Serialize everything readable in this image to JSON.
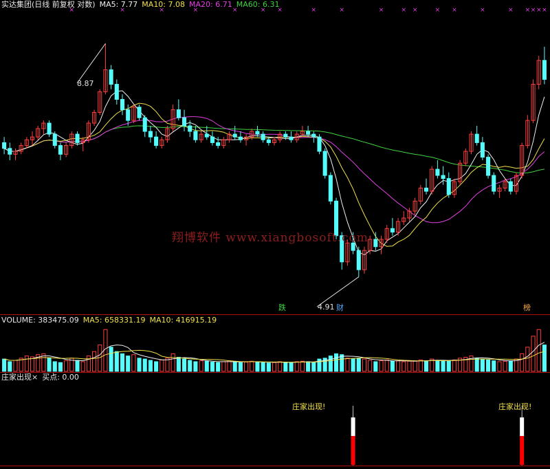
{
  "main_header": {
    "title": "实达集团(日线 前复权 对数)",
    "ma5": "MA5: 7.77",
    "ma10": "MA10: 7.08",
    "ma20": "MA20: 6.71",
    "ma60": "MA60: 6.31"
  },
  "volume_header": {
    "title": "VOLUME: 383475.09",
    "ma5": "MA5: 658331.19",
    "ma10": "MA10: 416915.19"
  },
  "signal_header": {
    "title": "庄家出现",
    "close_mark": "×",
    "buy_point": "买点: 0.00"
  },
  "annotations": {
    "high_label": "8.87",
    "low_label": "4.91",
    "tag_die": "跌",
    "tag_cai": "财",
    "tag_bang": "榜",
    "signal_text": "庄家出现!"
  },
  "watermark": "翔博软件 www.xiangbosoft.com",
  "colors": {
    "up": "#ff4040",
    "down": "#54fcfc",
    "ma5": "#f0f0f0",
    "ma10": "#f2e14a",
    "ma20": "#e23ee2",
    "ma60": "#3fd33f",
    "marker": "#e23ee2",
    "divider": "#b01010",
    "signal_red": "#ff0000"
  },
  "chart_data": {
    "type": "candlestick",
    "price_scale": "log",
    "price_range": [
      4.6,
      9.6
    ],
    "max_price": 8.87,
    "min_price": 4.91,
    "candles": [
      [
        6.9,
        7.0,
        6.7,
        6.8
      ],
      [
        6.8,
        6.9,
        6.6,
        6.7
      ],
      [
        6.7,
        6.8,
        6.6,
        6.75
      ],
      [
        6.75,
        6.9,
        6.7,
        6.85
      ],
      [
        6.85,
        7.0,
        6.8,
        6.95
      ],
      [
        6.95,
        7.1,
        6.85,
        7.0
      ],
      [
        7.0,
        7.2,
        6.95,
        7.15
      ],
      [
        7.15,
        7.3,
        7.05,
        7.25
      ],
      [
        7.25,
        7.3,
        7.0,
        7.05
      ],
      [
        7.05,
        7.1,
        6.8,
        6.85
      ],
      [
        6.85,
        6.9,
        6.6,
        6.7
      ],
      [
        6.7,
        6.9,
        6.65,
        6.85
      ],
      [
        6.85,
        7.1,
        6.8,
        7.05
      ],
      [
        7.05,
        7.1,
        6.85,
        6.9
      ],
      [
        6.9,
        7.0,
        6.75,
        6.95
      ],
      [
        6.95,
        7.3,
        6.9,
        7.25
      ],
      [
        7.25,
        7.5,
        7.2,
        7.45
      ],
      [
        7.45,
        7.9,
        7.4,
        7.85
      ],
      [
        7.85,
        8.87,
        7.8,
        8.3
      ],
      [
        8.3,
        8.4,
        7.9,
        8.0
      ],
      [
        8.0,
        8.1,
        7.6,
        7.7
      ],
      [
        7.7,
        7.8,
        7.4,
        7.5
      ],
      [
        7.5,
        7.6,
        7.2,
        7.3
      ],
      [
        7.3,
        7.6,
        7.25,
        7.55
      ],
      [
        7.55,
        7.6,
        7.3,
        7.35
      ],
      [
        7.35,
        7.4,
        7.0,
        7.1
      ],
      [
        7.1,
        7.2,
        6.9,
        7.0
      ],
      [
        7.0,
        7.1,
        6.8,
        6.85
      ],
      [
        6.85,
        7.0,
        6.8,
        6.95
      ],
      [
        6.95,
        7.2,
        6.9,
        7.15
      ],
      [
        7.15,
        7.6,
        7.1,
        7.5
      ],
      [
        7.5,
        7.7,
        7.3,
        7.35
      ],
      [
        7.35,
        7.5,
        7.1,
        7.2
      ],
      [
        7.2,
        7.3,
        7.0,
        7.1
      ],
      [
        7.1,
        7.2,
        6.9,
        6.95
      ],
      [
        6.95,
        7.1,
        6.9,
        7.05
      ],
      [
        7.05,
        7.2,
        6.95,
        7.0
      ],
      [
        7.0,
        7.1,
        6.85,
        6.9
      ],
      [
        6.9,
        7.0,
        6.8,
        6.85
      ],
      [
        6.85,
        7.0,
        6.8,
        6.95
      ],
      [
        6.95,
        7.1,
        6.9,
        7.05
      ],
      [
        7.05,
        7.2,
        6.95,
        7.0
      ],
      [
        7.0,
        7.1,
        6.9,
        6.95
      ],
      [
        6.95,
        7.05,
        6.85,
        7.0
      ],
      [
        7.0,
        7.15,
        6.95,
        7.1
      ],
      [
        7.1,
        7.2,
        7.0,
        7.05
      ],
      [
        7.05,
        7.1,
        6.9,
        6.95
      ],
      [
        6.95,
        7.0,
        6.85,
        6.9
      ],
      [
        6.9,
        7.0,
        6.85,
        6.95
      ],
      [
        6.95,
        7.1,
        6.9,
        7.05
      ],
      [
        7.05,
        7.1,
        6.95,
        7.0
      ],
      [
        7.0,
        7.1,
        6.9,
        6.95
      ],
      [
        6.95,
        7.1,
        6.9,
        7.05
      ],
      [
        7.05,
        7.2,
        7.0,
        7.1
      ],
      [
        7.1,
        7.2,
        7.0,
        7.05
      ],
      [
        7.05,
        7.1,
        6.9,
        7.0
      ],
      [
        7.0,
        7.05,
        6.7,
        6.75
      ],
      [
        6.75,
        6.8,
        6.3,
        6.35
      ],
      [
        6.35,
        6.4,
        5.9,
        5.95
      ],
      [
        5.95,
        6.0,
        5.4,
        5.45
      ],
      [
        5.45,
        5.5,
        5.0,
        5.1
      ],
      [
        5.1,
        5.4,
        5.05,
        5.35
      ],
      [
        5.35,
        5.5,
        5.2,
        5.25
      ],
      [
        5.25,
        5.3,
        4.91,
        5.0
      ],
      [
        5.0,
        5.3,
        4.95,
        5.25
      ],
      [
        5.25,
        5.45,
        5.2,
        5.4
      ],
      [
        5.4,
        5.5,
        5.25,
        5.3
      ],
      [
        5.3,
        5.45,
        5.2,
        5.4
      ],
      [
        5.4,
        5.6,
        5.35,
        5.55
      ],
      [
        5.55,
        5.7,
        5.45,
        5.5
      ],
      [
        5.5,
        5.7,
        5.45,
        5.65
      ],
      [
        5.65,
        5.8,
        5.6,
        5.7
      ],
      [
        5.7,
        5.85,
        5.65,
        5.8
      ],
      [
        5.8,
        6.0,
        5.75,
        5.95
      ],
      [
        5.95,
        6.2,
        5.9,
        6.15
      ],
      [
        6.15,
        6.3,
        6.05,
        6.1
      ],
      [
        6.1,
        6.5,
        6.05,
        6.45
      ],
      [
        6.45,
        6.6,
        6.3,
        6.35
      ],
      [
        6.35,
        6.5,
        6.2,
        6.3
      ],
      [
        6.3,
        6.4,
        6.0,
        6.05
      ],
      [
        6.05,
        6.3,
        6.0,
        6.25
      ],
      [
        6.25,
        6.6,
        6.2,
        6.55
      ],
      [
        6.55,
        6.8,
        6.5,
        6.75
      ],
      [
        6.75,
        7.1,
        6.7,
        7.05
      ],
      [
        7.05,
        7.2,
        6.85,
        6.9
      ],
      [
        6.9,
        7.0,
        6.6,
        6.65
      ],
      [
        6.65,
        6.7,
        6.3,
        6.35
      ],
      [
        6.35,
        6.4,
        6.05,
        6.1
      ],
      [
        6.1,
        6.2,
        6.0,
        6.15
      ],
      [
        6.15,
        6.3,
        6.1,
        6.25
      ],
      [
        6.25,
        6.3,
        6.05,
        6.1
      ],
      [
        6.1,
        6.4,
        6.05,
        6.35
      ],
      [
        6.35,
        6.9,
        6.3,
        6.85
      ],
      [
        6.85,
        7.4,
        6.8,
        7.3
      ],
      [
        7.3,
        8.1,
        7.25,
        8.0
      ],
      [
        8.0,
        8.6,
        7.9,
        8.5
      ],
      [
        8.5,
        8.8,
        8.0,
        8.1
      ]
    ],
    "volume": [
      0.28,
      0.22,
      0.25,
      0.3,
      0.35,
      0.33,
      0.38,
      0.4,
      0.3,
      0.22,
      0.2,
      0.24,
      0.3,
      0.25,
      0.22,
      0.35,
      0.45,
      0.6,
      0.95,
      0.55,
      0.45,
      0.4,
      0.35,
      0.38,
      0.3,
      0.28,
      0.25,
      0.22,
      0.26,
      0.3,
      0.4,
      0.32,
      0.28,
      0.25,
      0.22,
      0.24,
      0.23,
      0.21,
      0.2,
      0.22,
      0.24,
      0.22,
      0.2,
      0.21,
      0.23,
      0.22,
      0.2,
      0.19,
      0.2,
      0.22,
      0.21,
      0.2,
      0.22,
      0.23,
      0.22,
      0.21,
      0.28,
      0.3,
      0.35,
      0.4,
      0.38,
      0.3,
      0.28,
      0.3,
      0.28,
      0.25,
      0.22,
      0.24,
      0.26,
      0.23,
      0.24,
      0.22,
      0.23,
      0.24,
      0.26,
      0.24,
      0.28,
      0.25,
      0.23,
      0.24,
      0.26,
      0.3,
      0.32,
      0.35,
      0.3,
      0.28,
      0.26,
      0.24,
      0.22,
      0.23,
      0.24,
      0.28,
      0.4,
      0.55,
      0.8,
      0.95,
      0.6
    ],
    "signals": [
      62,
      92
    ]
  }
}
